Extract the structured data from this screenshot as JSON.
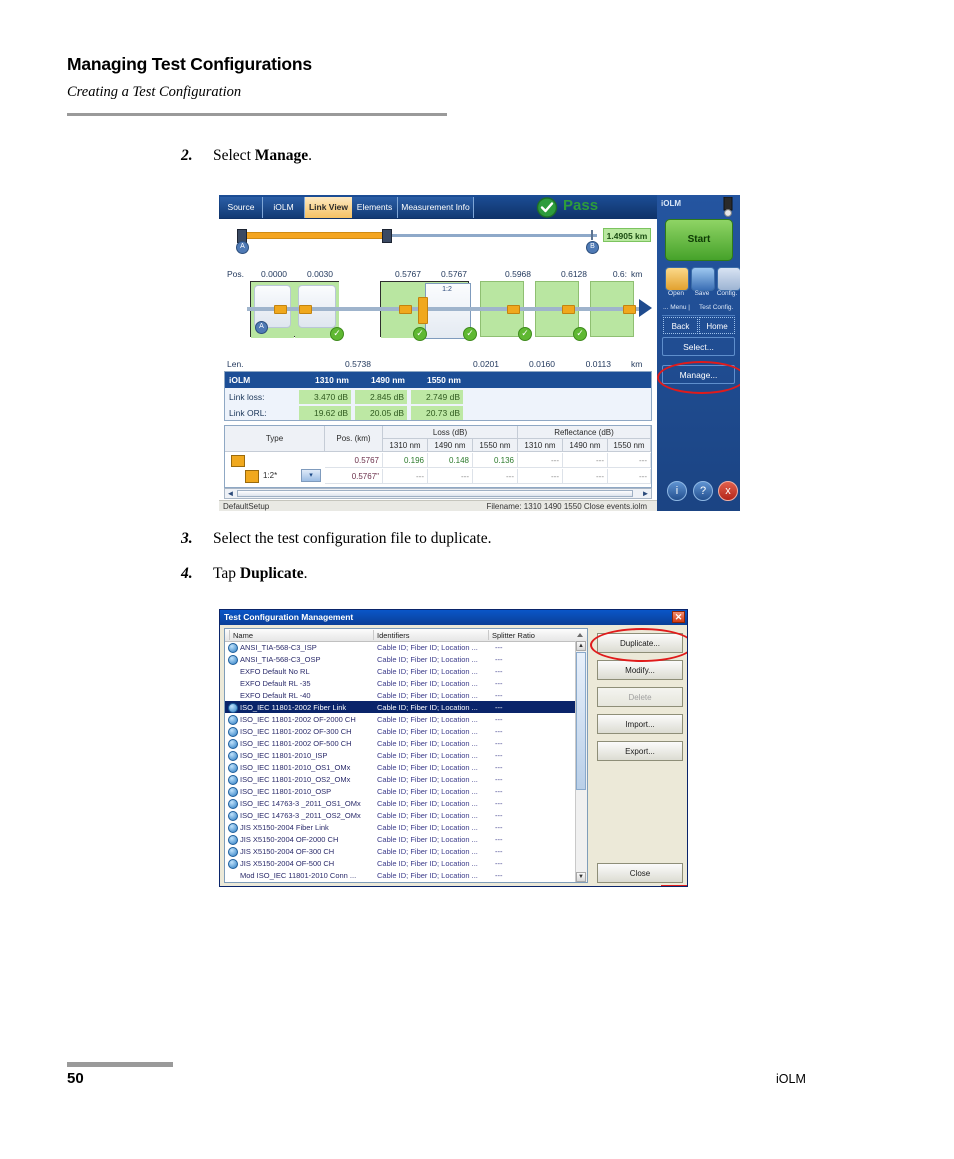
{
  "document": {
    "title": "Managing Test Configurations",
    "subtitle": "Creating a Test Configuration",
    "page_number": "50",
    "footer_right": "iOLM"
  },
  "steps": [
    {
      "num": "2.",
      "text_before": "Select ",
      "bold": "Manage",
      "text_after": "."
    },
    {
      "num": "3.",
      "text_before": "Select the test configuration file to duplicate.",
      "bold": "",
      "text_after": ""
    },
    {
      "num": "4.",
      "text_before": "Tap ",
      "bold": "Duplicate",
      "text_after": "."
    }
  ],
  "iolm_screen": {
    "tabs": [
      {
        "label": "Source",
        "active": false
      },
      {
        "label": "iOLM",
        "active": false
      },
      {
        "label": "Link View",
        "active": true
      },
      {
        "label": "Elements",
        "active": false
      },
      {
        "label": "Measurement Info",
        "active": false
      }
    ],
    "status": {
      "label": "Pass",
      "icon": "check-circle-icon",
      "color": "#2d9c3c"
    },
    "overview": {
      "distance": "1.4905 km",
      "marker_a": "A",
      "marker_b": "B"
    },
    "axis": {
      "pos_label": "Pos.",
      "len_label": "Len.",
      "unit": "km",
      "positions": [
        "0.0000",
        "0.0030",
        "0.5767",
        "0.5767",
        "0.5968",
        "0.6128",
        "0.6:"
      ],
      "lengths": [
        "0.5738",
        "0.0201",
        "0.0160",
        "0.0113"
      ]
    },
    "splitter_label": "1:2",
    "summary": {
      "title": "iOLM",
      "columns": [
        "1310 nm",
        "1490 nm",
        "1550 nm"
      ],
      "rows": [
        {
          "label": "Link loss:",
          "values": [
            "3.470 dB",
            "2.845 dB",
            "2.749 dB"
          ]
        },
        {
          "label": "Link ORL:",
          "values": [
            "19.62 dB",
            "20.05 dB",
            "20.73 dB"
          ]
        }
      ]
    },
    "events": {
      "group_headers": [
        "Type",
        "Pos. (km)",
        "Loss (dB)",
        "Reflectance (dB)"
      ],
      "sub_headers": [
        "1310 nm",
        "1490 nm",
        "1550 nm",
        "1310 nm",
        "1490 nm",
        "1550 nm"
      ],
      "rows": [
        {
          "type_icon": "splice-icon",
          "type_text": "",
          "pos": "0.5767",
          "loss": [
            "0.196",
            "0.148",
            "0.136"
          ],
          "refl": [
            "---",
            "---",
            "---"
          ]
        },
        {
          "type_icon": "splitter-icon",
          "type_text": "1:2*",
          "pos": "0.5767\"",
          "loss": [
            "---",
            "---",
            "---"
          ],
          "refl": [
            "---",
            "---",
            "---"
          ]
        }
      ]
    },
    "statusbar": {
      "left": "DefaultSetup",
      "right": "Filename: 1310 1490 1550 Close events.iolm"
    },
    "sidepanel": {
      "title": "iOLM",
      "start_label": "Start",
      "tools": [
        {
          "label": "Open",
          "icon": "folder-open-icon"
        },
        {
          "label": "Save",
          "icon": "floppy-save-icon"
        },
        {
          "label": "Config.",
          "icon": "config-icon"
        }
      ],
      "menu_strip": {
        "left": "... Menu |",
        "right": "Test Config."
      },
      "nav": [
        {
          "label": "Back"
        },
        {
          "label": "Home"
        }
      ],
      "actions": [
        {
          "label": "Select..."
        },
        {
          "label": "Manage...",
          "highlighted": true
        }
      ],
      "system_buttons": [
        {
          "label": "i",
          "icon": "info-icon",
          "color": "#2b5ea6"
        },
        {
          "label": "?",
          "icon": "help-icon",
          "color": "#2b5ea6"
        },
        {
          "label": "x",
          "icon": "close-icon",
          "color": "#c0392b"
        }
      ]
    }
  },
  "config_dialog": {
    "title": "Test Configuration Management",
    "close_icon": "close-icon",
    "columns": [
      "Name",
      "Identifiers",
      "Splitter Ratio"
    ],
    "rows": [
      {
        "name": "ANSI_TIA-568-C3_ISP",
        "identifiers": "Cable ID; Fiber ID; Location ...",
        "splitter": "---",
        "has_icon": true,
        "selected": false
      },
      {
        "name": "ANSI_TIA-568-C3_OSP",
        "identifiers": "Cable ID; Fiber ID; Location ...",
        "splitter": "---",
        "has_icon": true,
        "selected": false
      },
      {
        "name": "EXFO Default No RL",
        "identifiers": "Cable ID; Fiber ID; Location ...",
        "splitter": "---",
        "has_icon": false,
        "selected": false
      },
      {
        "name": "EXFO Default RL -35",
        "identifiers": "Cable ID; Fiber ID; Location ...",
        "splitter": "---",
        "has_icon": false,
        "selected": false
      },
      {
        "name": "EXFO Default RL -40",
        "identifiers": "Cable ID; Fiber ID; Location ...",
        "splitter": "---",
        "has_icon": false,
        "selected": false
      },
      {
        "name": "ISO_IEC 11801-2002 Fiber Link",
        "identifiers": "Cable ID; Fiber ID; Location ...",
        "splitter": "---",
        "has_icon": true,
        "selected": true
      },
      {
        "name": "ISO_IEC 11801-2002 OF-2000 CH",
        "identifiers": "Cable ID; Fiber ID; Location ...",
        "splitter": "---",
        "has_icon": true,
        "selected": false
      },
      {
        "name": "ISO_IEC 11801-2002 OF-300 CH",
        "identifiers": "Cable ID; Fiber ID; Location ...",
        "splitter": "---",
        "has_icon": true,
        "selected": false
      },
      {
        "name": "ISO_IEC 11801-2002 OF-500 CH",
        "identifiers": "Cable ID; Fiber ID; Location ...",
        "splitter": "---",
        "has_icon": true,
        "selected": false
      },
      {
        "name": "ISO_IEC 11801-2010_ISP",
        "identifiers": "Cable ID; Fiber ID; Location ...",
        "splitter": "---",
        "has_icon": true,
        "selected": false
      },
      {
        "name": "ISO_IEC 11801-2010_OS1_OMx",
        "identifiers": "Cable ID; Fiber ID; Location ...",
        "splitter": "---",
        "has_icon": true,
        "selected": false
      },
      {
        "name": "ISO_IEC 11801-2010_OS2_OMx",
        "identifiers": "Cable ID; Fiber ID; Location ...",
        "splitter": "---",
        "has_icon": true,
        "selected": false
      },
      {
        "name": "ISO_IEC 11801-2010_OSP",
        "identifiers": "Cable ID; Fiber ID; Location ...",
        "splitter": "---",
        "has_icon": true,
        "selected": false
      },
      {
        "name": "ISO_IEC 14763-3 _2011_OS1_OMx",
        "identifiers": "Cable ID; Fiber ID; Location ...",
        "splitter": "---",
        "has_icon": true,
        "selected": false
      },
      {
        "name": "ISO_IEC 14763-3 _2011_OS2_OMx",
        "identifiers": "Cable ID; Fiber ID; Location ...",
        "splitter": "---",
        "has_icon": true,
        "selected": false
      },
      {
        "name": "JIS X5150-2004 Fiber Link",
        "identifiers": "Cable ID; Fiber ID; Location ...",
        "splitter": "---",
        "has_icon": true,
        "selected": false
      },
      {
        "name": "JIS X5150-2004 OF-2000 CH",
        "identifiers": "Cable ID; Fiber ID; Location ...",
        "splitter": "---",
        "has_icon": true,
        "selected": false
      },
      {
        "name": "JIS X5150-2004 OF-300 CH",
        "identifiers": "Cable ID; Fiber ID; Location ...",
        "splitter": "---",
        "has_icon": true,
        "selected": false
      },
      {
        "name": "JIS X5150-2004 OF-500 CH",
        "identifiers": "Cable ID; Fiber ID; Location ...",
        "splitter": "---",
        "has_icon": true,
        "selected": false
      },
      {
        "name": "Mod ISO_IEC 11801-2010 Conn ...",
        "identifiers": "Cable ID; Fiber ID; Location ...",
        "splitter": "---",
        "has_icon": false,
        "selected": false
      }
    ],
    "buttons": [
      {
        "label": "Duplicate...",
        "disabled": false,
        "highlighted": true
      },
      {
        "label": "Modify...",
        "disabled": false,
        "highlighted": false
      },
      {
        "label": "Delete",
        "disabled": true,
        "highlighted": false
      },
      {
        "label": "Import...",
        "disabled": false,
        "highlighted": false
      },
      {
        "label": "Export...",
        "disabled": false,
        "highlighted": false
      }
    ],
    "close_button": {
      "label": "Close"
    }
  }
}
